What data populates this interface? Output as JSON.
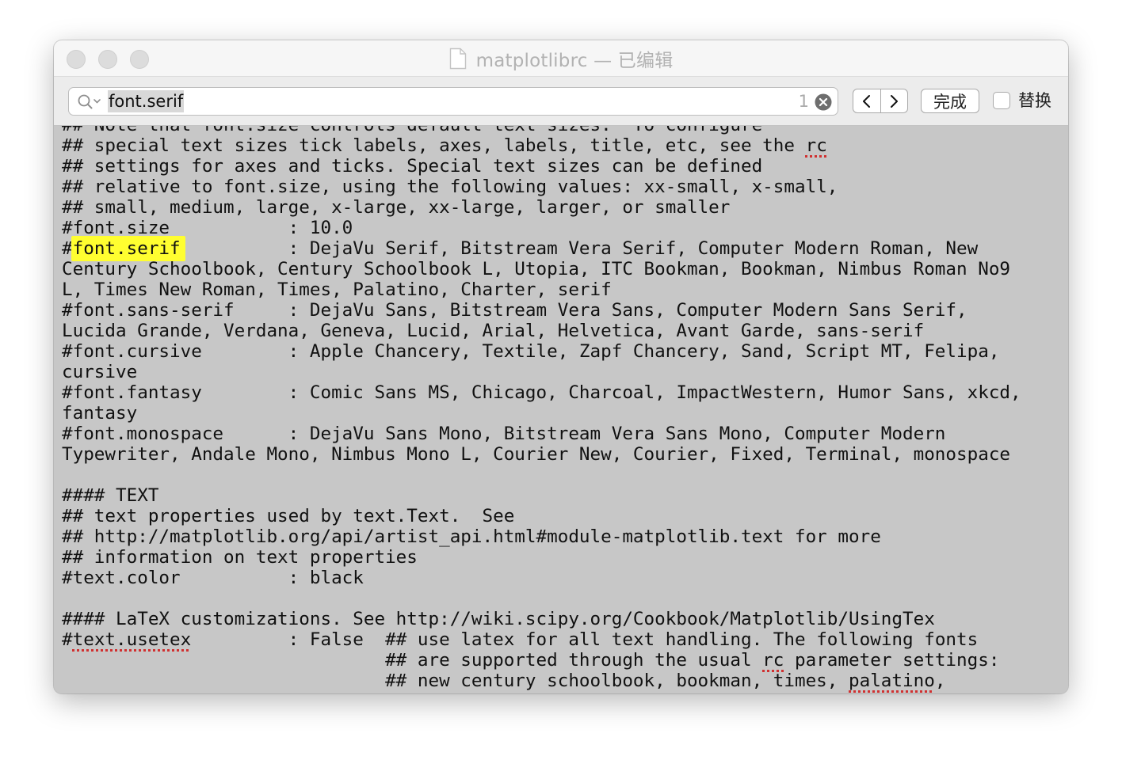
{
  "window": {
    "title": "matplotlibrc — 已编辑",
    "document_icon": "document-icon"
  },
  "findbar": {
    "search_value": "font.serif",
    "match_count": "1",
    "prev_label": "<",
    "next_label": ">",
    "done_label": "完成",
    "replace_label": "替换",
    "replace_checked": false
  },
  "editor": {
    "highlight_color": "#fffe30",
    "background": "#c7c7c7",
    "lines": [
      [
        {
          "t": "## Note that font.size controls default text sizes.  To configure"
        }
      ],
      [
        {
          "t": "## special text sizes tick labels, axes, labels, title, etc, see the "
        },
        {
          "t": "rc",
          "s": "spell"
        }
      ],
      [
        {
          "t": "## settings for axes and ticks. Special text sizes can be defined"
        }
      ],
      [
        {
          "t": "## relative to font.size, using the following values: xx-small, x-small,"
        }
      ],
      [
        {
          "t": "## small, medium, large, x-large, xx-large, larger, or smaller"
        }
      ],
      [
        {
          "t": "#font.size           : 10.0"
        }
      ],
      [
        {
          "t": "#"
        },
        {
          "t": "font.serif",
          "s": "hl"
        },
        {
          "t": "          : DejaVu Serif, Bitstream Vera Serif, Computer Modern Roman, New"
        }
      ],
      [
        {
          "t": "Century Schoolbook, Century Schoolbook L, Utopia, ITC Bookman, Bookman, Nimbus Roman No9"
        }
      ],
      [
        {
          "t": "L, Times New Roman, Times, Palatino, Charter, serif"
        }
      ],
      [
        {
          "t": "#font.sans-serif     : DejaVu Sans, Bitstream Vera Sans, Computer Modern Sans Serif,"
        }
      ],
      [
        {
          "t": "Lucida Grande, Verdana, Geneva, Lucid, Arial, Helvetica, Avant Garde, sans-serif"
        }
      ],
      [
        {
          "t": "#font.cursive        : Apple Chancery, Textile, Zapf Chancery, Sand, Script MT, Felipa,"
        }
      ],
      [
        {
          "t": "cursive"
        }
      ],
      [
        {
          "t": "#font.fantasy        : Comic Sans MS, Chicago, Charcoal, ImpactWestern, Humor Sans, xkcd,"
        }
      ],
      [
        {
          "t": "fantasy"
        }
      ],
      [
        {
          "t": "#font.monospace      : DejaVu Sans Mono, Bitstream Vera Sans Mono, Computer Modern"
        }
      ],
      [
        {
          "t": "Typewriter, Andale Mono, Nimbus Mono L, Courier New, Courier, Fixed, Terminal, monospace"
        }
      ],
      [
        {
          "t": ""
        }
      ],
      [
        {
          "t": "#### TEXT"
        }
      ],
      [
        {
          "t": "## text properties used by text.Text.  See"
        }
      ],
      [
        {
          "t": "## http://matplotlib.org/api/artist_api.html#module-matplotlib.text for more"
        }
      ],
      [
        {
          "t": "## information on text properties"
        }
      ],
      [
        {
          "t": "#text.color          : black"
        }
      ],
      [
        {
          "t": ""
        }
      ],
      [
        {
          "t": "#### LaTeX customizations. See http://wiki.scipy.org/Cookbook/Matplotlib/UsingTex"
        }
      ],
      [
        {
          "t": "#"
        },
        {
          "t": "text.usetex",
          "s": "spell"
        },
        {
          "t": "         : False  ## use latex for all text handling. The following fonts"
        }
      ],
      [
        {
          "t": "                              ## are supported through the usual "
        },
        {
          "t": "rc",
          "s": "spell"
        },
        {
          "t": " parameter settings:"
        }
      ],
      [
        {
          "t": "                              ## new century schoolbook, bookman, times, "
        },
        {
          "t": "palatino",
          "s": "spell"
        },
        {
          "t": ","
        }
      ]
    ]
  }
}
